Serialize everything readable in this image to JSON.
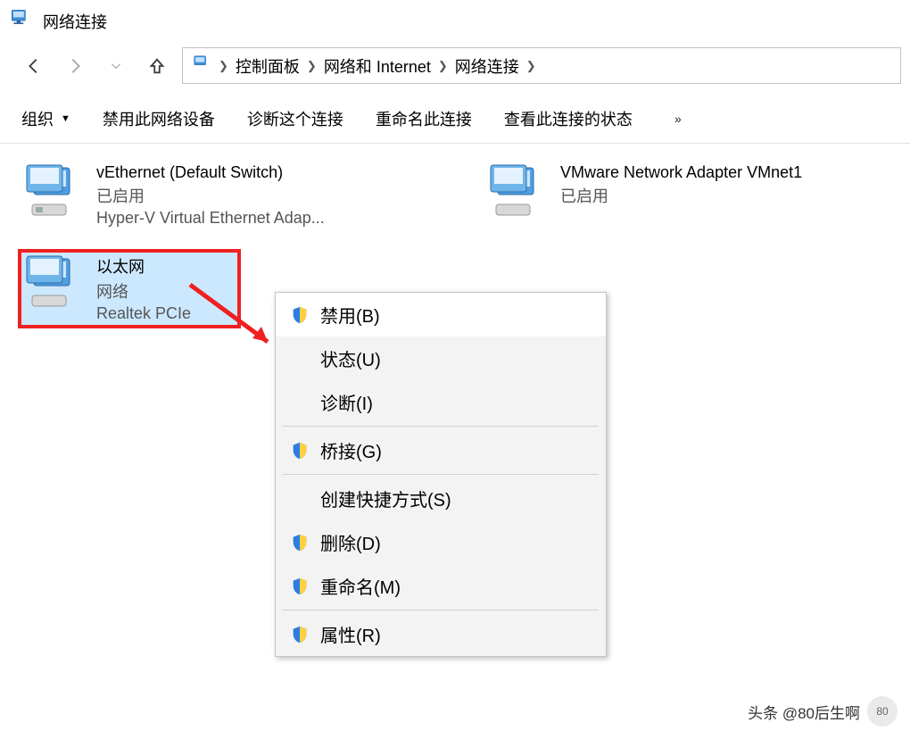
{
  "window": {
    "title": "网络连接"
  },
  "breadcrumb": {
    "items": [
      "控制面板",
      "网络和 Internet",
      "网络连接"
    ]
  },
  "toolbar": {
    "organize": "组织",
    "disable_device": "禁用此网络设备",
    "diagnose": "诊断这个连接",
    "rename": "重命名此连接",
    "view_status": "查看此连接的状态"
  },
  "adapters": [
    {
      "name": "vEthernet (Default Switch)",
      "status": "已启用",
      "device": "Hyper-V Virtual Ethernet Adap..."
    },
    {
      "name": "VMware Network Adapter VMnet1",
      "status": "已启用",
      "device": ""
    },
    {
      "name": "以太网",
      "status": "网络",
      "device": "Realtek PCIe"
    }
  ],
  "context_menu": {
    "items": [
      {
        "label": "禁用(B)",
        "shield": true,
        "hover": true
      },
      {
        "label": "状态(U)",
        "shield": false
      },
      {
        "label": "诊断(I)",
        "shield": false
      },
      {
        "sep": true
      },
      {
        "label": "桥接(G)",
        "shield": true
      },
      {
        "sep": true
      },
      {
        "label": "创建快捷方式(S)",
        "shield": false
      },
      {
        "label": "删除(D)",
        "shield": true
      },
      {
        "label": "重命名(M)",
        "shield": true
      },
      {
        "sep": true
      },
      {
        "label": "属性(R)",
        "shield": true
      }
    ]
  },
  "watermark": {
    "text": "头条 @80后生啊",
    "avatar": "80"
  }
}
